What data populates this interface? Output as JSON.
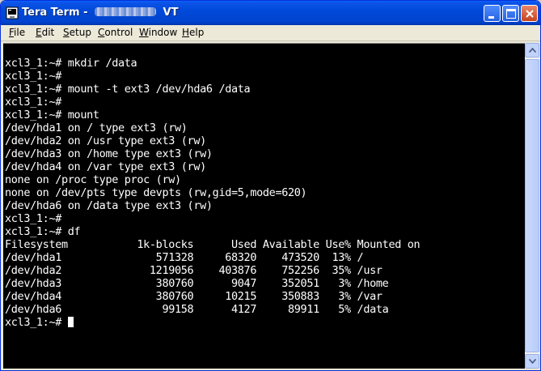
{
  "window": {
    "title_prefix": "Tera Term - ",
    "title_suffix": " VT",
    "colors": {
      "titlebar": "#0049d8",
      "terminal_bg": "#000000",
      "terminal_fg": "#ffffff"
    }
  },
  "titlebar_icons": [
    "tera-term-app-icon",
    "minimize-icon",
    "maximize-icon",
    "close-icon"
  ],
  "menu": {
    "file": {
      "mn": "F",
      "rest": "ile"
    },
    "edit": {
      "mn": "E",
      "rest": "dit"
    },
    "setup": {
      "mn": "S",
      "rest": "etup"
    },
    "control": {
      "mn": "C",
      "rest": "ontrol"
    },
    "window": {
      "mn": "W",
      "rest": "indow"
    },
    "help": {
      "mn": "H",
      "rest": "elp"
    }
  },
  "terminal": {
    "lines": [
      "xcl3_1:~# mkdir /data",
      "xcl3_1:~#",
      "xcl3_1:~# mount -t ext3 /dev/hda6 /data",
      "xcl3_1:~#",
      "xcl3_1:~# mount",
      "/dev/hda1 on / type ext3 (rw)",
      "/dev/hda2 on /usr type ext3 (rw)",
      "/dev/hda3 on /home type ext3 (rw)",
      "/dev/hda4 on /var type ext3 (rw)",
      "none on /proc type proc (rw)",
      "none on /dev/pts type devpts (rw,gid=5,mode=620)",
      "/dev/hda6 on /data type ext3 (rw)",
      "xcl3_1:~#",
      "xcl3_1:~# df",
      "Filesystem           1k-blocks      Used Available Use% Mounted on",
      "/dev/hda1               571328     68320    473520  13% /",
      "/dev/hda2              1219056    403876    752256  35% /usr",
      "/dev/hda3               380760      9047    352051   3% /home",
      "/dev/hda4               380760     10215    350883   3% /var",
      "/dev/hda6                99158      4127     89911   5% /data",
      "xcl3_1:~# "
    ]
  }
}
